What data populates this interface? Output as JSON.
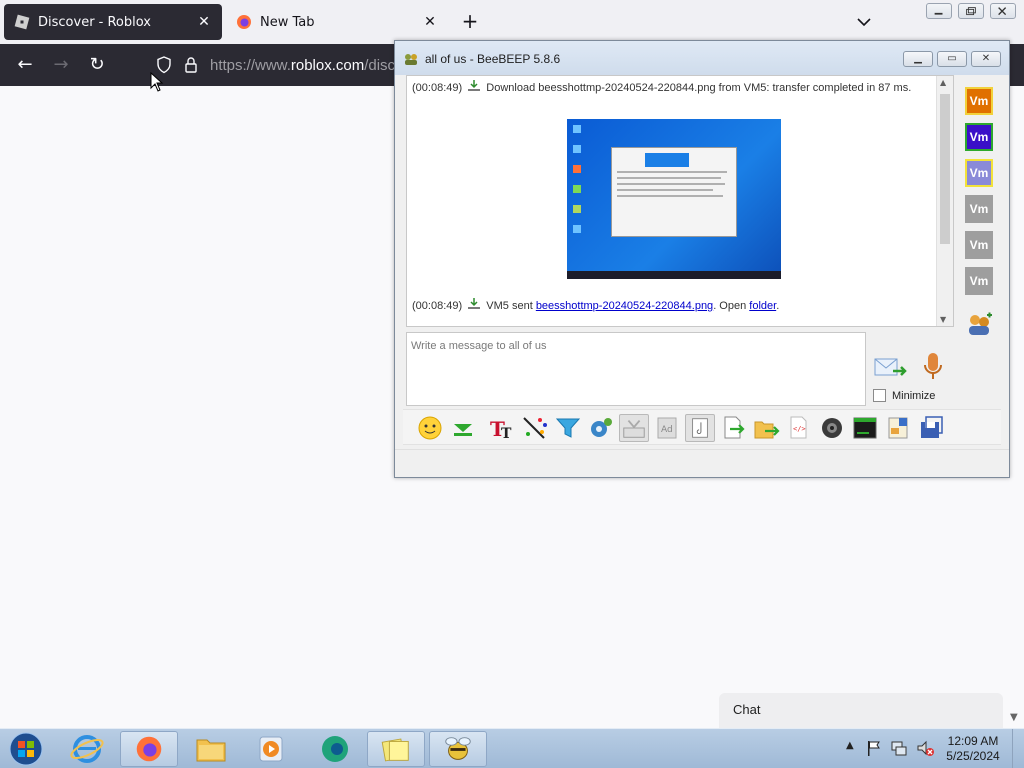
{
  "browser": {
    "tabs": [
      {
        "label": "Discover - Roblox",
        "active": true
      },
      {
        "label": "New Tab",
        "active": false
      }
    ],
    "url_prefix": "https://www.",
    "url_domain": "roblox.com",
    "url_rest": "/discov"
  },
  "beebeep": {
    "title": "all of us - BeeBEEP 5.8.6",
    "messages": [
      {
        "time": "(00:08:49)",
        "text": "Download beesshottmp-20240524-220844.png from VM5: transfer completed in 87 ms."
      },
      {
        "time": "(00:08:49)",
        "pre": "VM5 sent ",
        "link": "beesshottmp-20240524-220844.png",
        "mid": ". Open ",
        "link2": "folder",
        "post": "."
      }
    ],
    "users": [
      {
        "label": "Vm",
        "color": "#e07000"
      },
      {
        "label": "Vm",
        "color": "#3a10c8"
      },
      {
        "label": "Vm",
        "color": "#8a8ad8"
      },
      {
        "label": "Vm",
        "color": "#9e9e9e"
      },
      {
        "label": "Vm",
        "color": "#9e9e9e"
      },
      {
        "label": "Vm",
        "color": "#9e9e9e"
      }
    ],
    "input_placeholder": "Write a message to all of us",
    "minimize_label": "Minimize",
    "toolbar_icons": [
      "emoticon-icon",
      "collapse-icon",
      "font-icon",
      "color-icon",
      "filter-icon",
      "settings-icon",
      "save-chat-icon",
      "spellcheck-icon",
      "note-icon",
      "send-file-icon",
      "send-folder-icon",
      "html-icon",
      "screenshot-icon",
      "terminal-icon",
      "sticker-icon",
      "save-icon"
    ]
  },
  "chat_widget": {
    "label": "Chat"
  },
  "taskbar": {
    "apps": [
      "internet-explorer-icon",
      "firefox-icon",
      "file-explorer-icon",
      "media-player-icon",
      "chromium-edge-icon",
      "sticky-notes-icon",
      "beebeep-icon"
    ],
    "time": "12:09 AM",
    "date": "5/25/2024"
  }
}
